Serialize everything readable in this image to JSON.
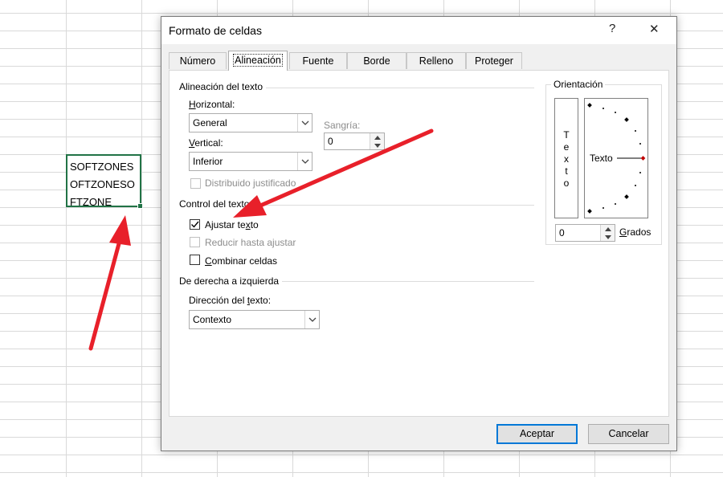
{
  "spreadsheet": {
    "cell_lines": [
      "SOFTZONES",
      "OFTZONESO",
      "FTZONE"
    ]
  },
  "dialog": {
    "title": "Formato de celdas",
    "help_label": "?",
    "close_label": "✕",
    "tabs": [
      {
        "label": "Número",
        "active": false
      },
      {
        "label": "Alineación",
        "active": true
      },
      {
        "label": "Fuente",
        "active": false
      },
      {
        "label": "Borde",
        "active": false
      },
      {
        "label": "Relleno",
        "active": false
      },
      {
        "label": "Proteger",
        "active": false
      }
    ],
    "text_alignment": {
      "group_label": "Alineación del texto",
      "horizontal_label_u": "H",
      "horizontal_label_rest": "orizontal:",
      "horizontal_value": "General",
      "vertical_label_u": "V",
      "vertical_label_rest": "ertical:",
      "vertical_value": "Inferior",
      "indent_label": "Sangría:",
      "indent_value": "0",
      "justify_distributed_label": "Distribuido justificado",
      "justify_distributed_checked": false
    },
    "text_control": {
      "group_label": "Control del texto",
      "wrap_text_label_pre": "Ajustar te",
      "wrap_text_label_u": "x",
      "wrap_text_label_post": "to",
      "wrap_text_checked": true,
      "shrink_label": "Reducir hasta ajustar",
      "shrink_checked": false,
      "merge_label_u": "C",
      "merge_label_rest": "ombinar celdas",
      "merge_checked": false
    },
    "rtl": {
      "group_label": "De derecha a izquierda",
      "direction_label_pre": "Dirección del ",
      "direction_label_u": "t",
      "direction_label_post": "exto:",
      "direction_value": "Contexto"
    },
    "orientation": {
      "group_label": "Orientación",
      "vertical_letters": [
        "T",
        "e",
        "x",
        "t",
        "o"
      ],
      "dial_label": "Texto",
      "degrees_value": "0",
      "degrees_label_u": "G",
      "degrees_label_rest": "rados"
    },
    "buttons": {
      "ok_label": "Aceptar",
      "cancel_label": "Cancelar"
    }
  },
  "colors": {
    "annotation_arrow": "#e8202a",
    "selection_border": "#217346",
    "focus_blue": "#0078d7",
    "dial_accent": "#c00000"
  }
}
